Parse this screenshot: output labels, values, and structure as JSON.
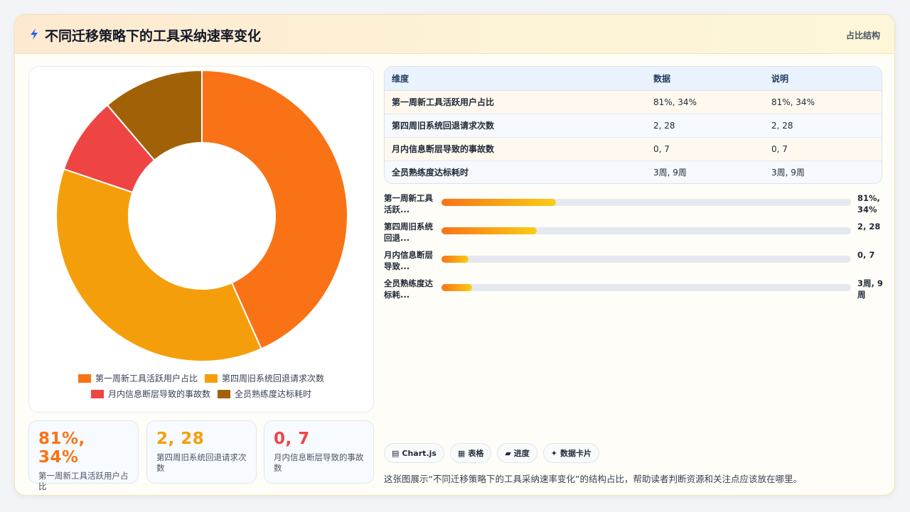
{
  "header": {
    "title": "不同迁移策略下的工具采纳速率变化",
    "tag": "占比结构"
  },
  "colors": {
    "orange": "#f97316",
    "amber": "#f59e0b",
    "red": "#ef4444",
    "brown": "#a16207"
  },
  "chart_data": {
    "type": "pie",
    "variant": "doughnut",
    "categories": [
      "第一周新工具活跃用户占比",
      "第四周旧系统回退请求次数",
      "月内信息断层导致的事故数",
      "全员熟练度达标耗时"
    ],
    "values": [
      81,
      69,
      16,
      21
    ],
    "colors": [
      "#f97316",
      "#f59e0b",
      "#ef4444",
      "#a16207"
    ],
    "legend": "bottom"
  },
  "table": {
    "headers": [
      "维度",
      "数据",
      "说明"
    ],
    "rows": [
      [
        "第一周新工具活跃用户占比",
        "81%, 34%",
        "81%, 34%"
      ],
      [
        "第四周旧系统回退请求次数",
        "2, 28",
        "2, 28"
      ],
      [
        "月内信息断层导致的事故数",
        "0, 7",
        "0, 7"
      ],
      [
        "全员熟练度达标耗时",
        "3周, 9周",
        "3周, 9周"
      ]
    ]
  },
  "bars": [
    {
      "label": "第一周新工具活跃...",
      "value": "81%, 34%",
      "fraction": 0.28
    },
    {
      "label": "第四周旧系统回退...",
      "value": "2, 28",
      "fraction": 0.233
    },
    {
      "label": "月内信息断层导致...",
      "value": "0, 7",
      "fraction": 0.066
    },
    {
      "label": "全员熟练度达标耗...",
      "value": "3周, 9周",
      "fraction": 0.074
    }
  ],
  "kpis": [
    {
      "value": "81%, 34%",
      "label": "第一周新工具活跃用户占比",
      "color": "#f97316"
    },
    {
      "value": "2, 28",
      "label": "第四周旧系统回退请求次数",
      "color": "#f59e0b"
    },
    {
      "value": "0, 7",
      "label": "月内信息断层导致的事故数",
      "color": "#ef4444"
    }
  ],
  "chips": [
    {
      "icon": "chart-icon",
      "glyph": "▤",
      "label": "Chart.js"
    },
    {
      "icon": "table-icon",
      "glyph": "▦",
      "label": "表格"
    },
    {
      "icon": "progress-icon",
      "glyph": "▰",
      "label": "进度"
    },
    {
      "icon": "sparkle-icon",
      "glyph": "✦",
      "label": "数据卡片"
    }
  ],
  "note": "这张图展示“不同迁移策略下的工具采纳速率变化”的结构占比，帮助读者判断资源和关注点应该放在哪里。"
}
